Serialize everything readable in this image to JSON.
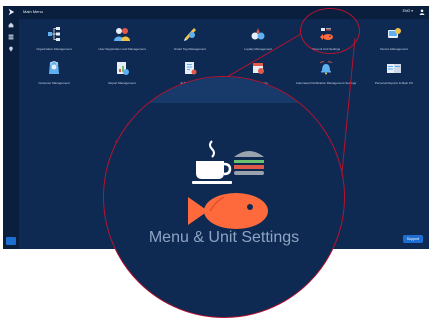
{
  "topbar": {
    "title": "Main Menu",
    "language": "ENG ▾",
    "user_icon": "user-icon"
  },
  "tiles": [
    {
      "label": "Organization Management",
      "icon": "org-tree-icon"
    },
    {
      "label": "User Registration and Management",
      "icon": "users-icon"
    },
    {
      "label": "Smart Tag Management",
      "icon": "tag-icon"
    },
    {
      "label": "Loyalty Management",
      "icon": "loyalty-icon"
    },
    {
      "label": "Menu & Unit Settings",
      "icon": "menu-unit-icon"
    },
    {
      "label": "Device Management",
      "icon": "device-icon"
    },
    {
      "label": "Customer Management",
      "icon": "customer-icon"
    },
    {
      "label": "Report Management",
      "icon": "report-icon"
    },
    {
      "label": "E-Bill Settings",
      "icon": "ebill-icon"
    },
    {
      "label": "Event Settings",
      "icon": "event-icon"
    },
    {
      "label": "Automated Notification Management Settings",
      "icon": "notification-icon"
    },
    {
      "label": "Personal Reports & Main PC",
      "icon": "personal-report-icon"
    }
  ],
  "support_button": "Support",
  "magnifier": {
    "label": "Menu & Unit Settings"
  },
  "colors": {
    "background": "#0e2a52",
    "rail": "#0a1f3d",
    "accent": "#1c6fd0",
    "callout": "#b8122e"
  }
}
